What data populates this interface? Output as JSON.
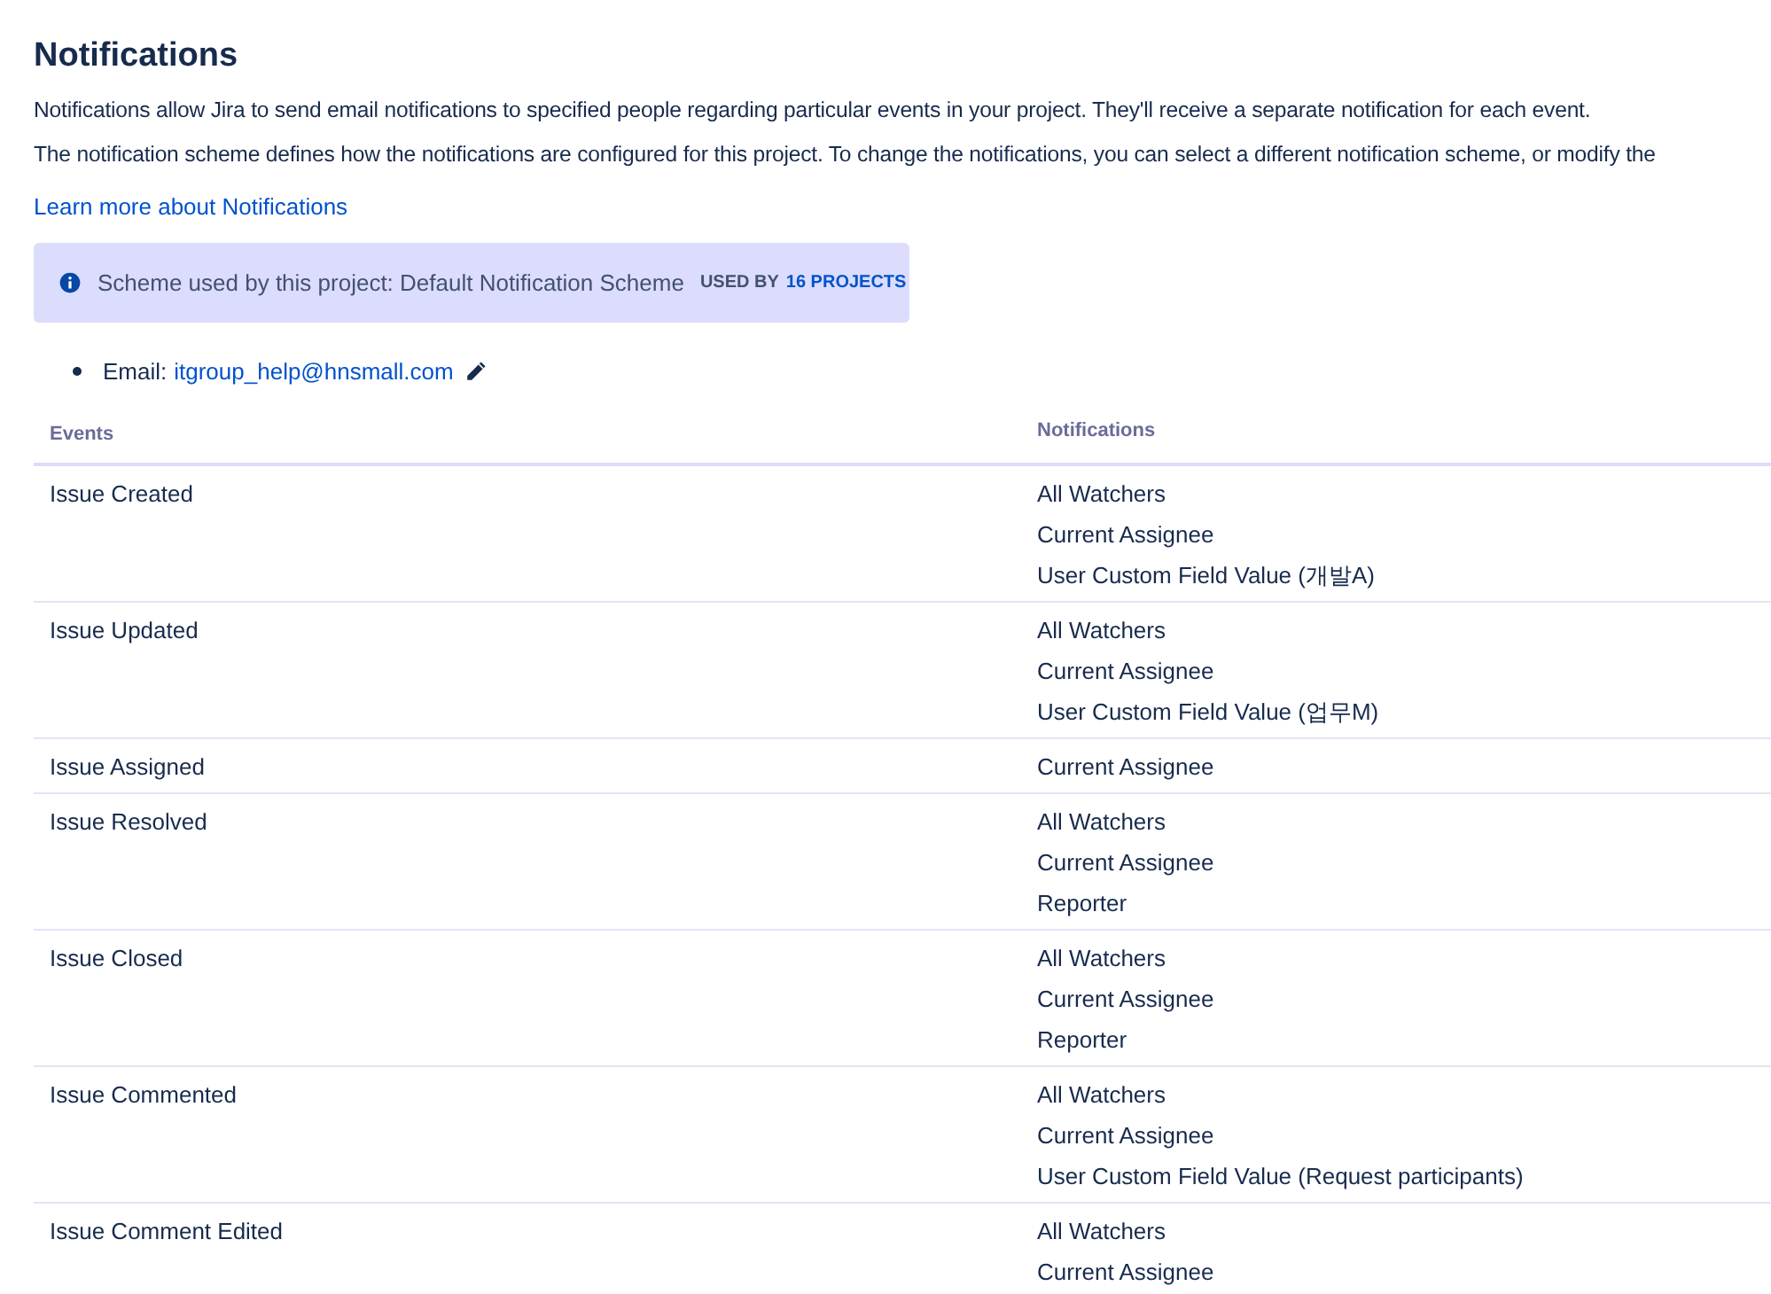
{
  "heading": "Notifications",
  "paragraphs": [
    "Notifications allow Jira to send email notifications to specified people regarding particular events in your project. They'll receive a separate notification for each event.",
    "The notification scheme defines how the notifications are configured for this project. To change the notifications, you can select a different notification scheme, or modify the"
  ],
  "learn_more_link": "Learn more about Notifications",
  "scheme_banner": {
    "text": "Scheme used by this project: Default Notification Scheme",
    "used_by": "USED BY",
    "projects_link": "16 PROJECTS"
  },
  "email": {
    "label": "Email:",
    "address": "itgroup_help@hnsmall.com"
  },
  "table": {
    "columns": [
      "Events",
      "Notifications"
    ],
    "rows": [
      {
        "event": "Issue Created",
        "notifications": [
          "All Watchers",
          "Current Assignee",
          "User Custom Field Value (개발A)"
        ]
      },
      {
        "event": "Issue Updated",
        "notifications": [
          "All Watchers",
          "Current Assignee",
          "User Custom Field Value (업무M)"
        ]
      },
      {
        "event": "Issue Assigned",
        "notifications": [
          "Current Assignee"
        ]
      },
      {
        "event": "Issue Resolved",
        "notifications": [
          "All Watchers",
          "Current Assignee",
          "Reporter"
        ]
      },
      {
        "event": "Issue Closed",
        "notifications": [
          "All Watchers",
          "Current Assignee",
          "Reporter"
        ]
      },
      {
        "event": "Issue Commented",
        "notifications": [
          "All Watchers",
          "Current Assignee",
          "User Custom Field Value (Request participants)"
        ]
      },
      {
        "event": "Issue Comment Edited",
        "notifications": [
          "All Watchers",
          "Current Assignee"
        ]
      }
    ]
  }
}
